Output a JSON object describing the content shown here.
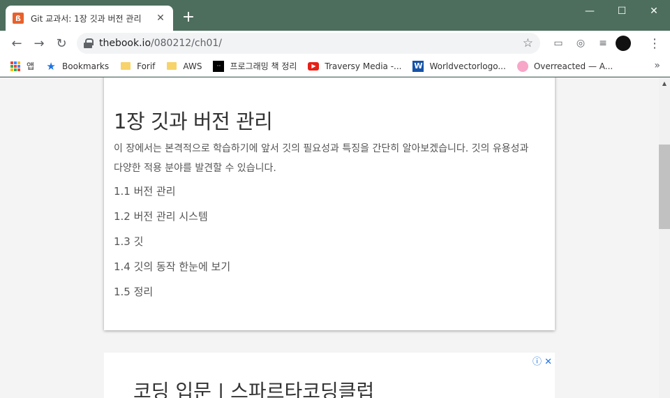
{
  "tab": {
    "favicon_letter": "ß",
    "title": "Git 교과서: 1장 깃과 버전 관리",
    "close": "✕"
  },
  "window": {
    "new_tab": "+",
    "minimize": "—",
    "maximize": "☐",
    "close": "✕"
  },
  "toolbar": {
    "back": "←",
    "forward": "→",
    "reload": "↻",
    "url_host": "thebook.io",
    "url_path": "/080212/ch01/",
    "star": "☆",
    "menu": "⋮"
  },
  "bookmarks": [
    {
      "label": "앱",
      "icon": "apps-grid-icon"
    },
    {
      "label": "Bookmarks",
      "icon": "star-icon"
    },
    {
      "label": "Forif",
      "icon": "folder-icon"
    },
    {
      "label": "AWS",
      "icon": "folder-icon"
    },
    {
      "label": "프로그래밍 책 정리",
      "icon": "notion-icon"
    },
    {
      "label": "Traversy Media -...",
      "icon": "youtube-icon"
    },
    {
      "label": "Worldvectorlogo...",
      "icon": "w-logo-icon"
    },
    {
      "label": "Overreacted — A...",
      "icon": "pink-circle-icon"
    }
  ],
  "bookmarks_more": "»",
  "article": {
    "title": "1장 깃과 버전 관리",
    "intro": "이 장에서는 본격적으로 학습하기에 앞서 깃의 필요성과 특징을 간단히 알아보겠습니다. 깃의 유용성과 다양한 적용 분야를 발견할 수 있습니다.",
    "toc": [
      "1.1 버전 관리",
      "1.2 버전 관리 시스템",
      "1.3 깃",
      "1.4 깃의 동작 한눈에 보기",
      "1.5 정리"
    ]
  },
  "ad": {
    "text": "코딩 입문 | 스파르타코딩클럽",
    "icons": "ⓘ ✕"
  },
  "scroll": {
    "position_fraction": 0.21
  },
  "colors": {
    "frame": "#4d6e5d",
    "accent": "#1a73e8"
  }
}
